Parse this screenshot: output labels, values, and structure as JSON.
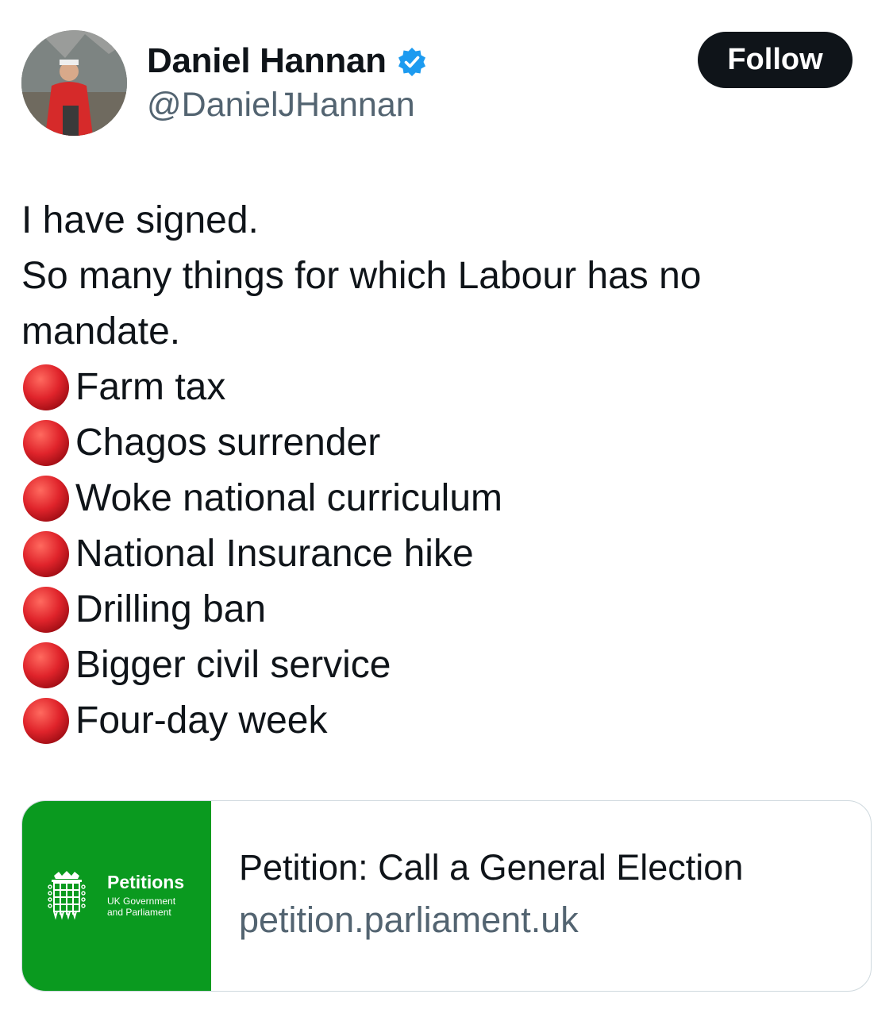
{
  "author": {
    "display_name": "Daniel Hannan",
    "handle": "@DanielJHannan",
    "verified": true
  },
  "follow_button": {
    "label": "Follow"
  },
  "tweet": {
    "lines": [
      "I have signed.",
      "So many things for which Labour has no",
      "mandate."
    ],
    "bullet_icon": "red-circle-emoji",
    "bullets": [
      "Farm tax",
      "Chagos surrender",
      "Woke national curriculum",
      "National Insurance hike",
      "Drilling ban",
      "Bigger civil service",
      "Four-day week"
    ]
  },
  "link_card": {
    "thumb_title": "Petitions",
    "thumb_subtitle": "UK Government\nand Parliament",
    "title": "Petition: Call a General Election",
    "domain": "petition.parliament.uk"
  },
  "colors": {
    "text": "#0f1419",
    "secondary_text": "#536471",
    "verified_blue": "#1d9bf0",
    "follow_bg": "#0f1419",
    "petitions_green": "#0a9a1f",
    "bullet_red": "#e0242b"
  }
}
